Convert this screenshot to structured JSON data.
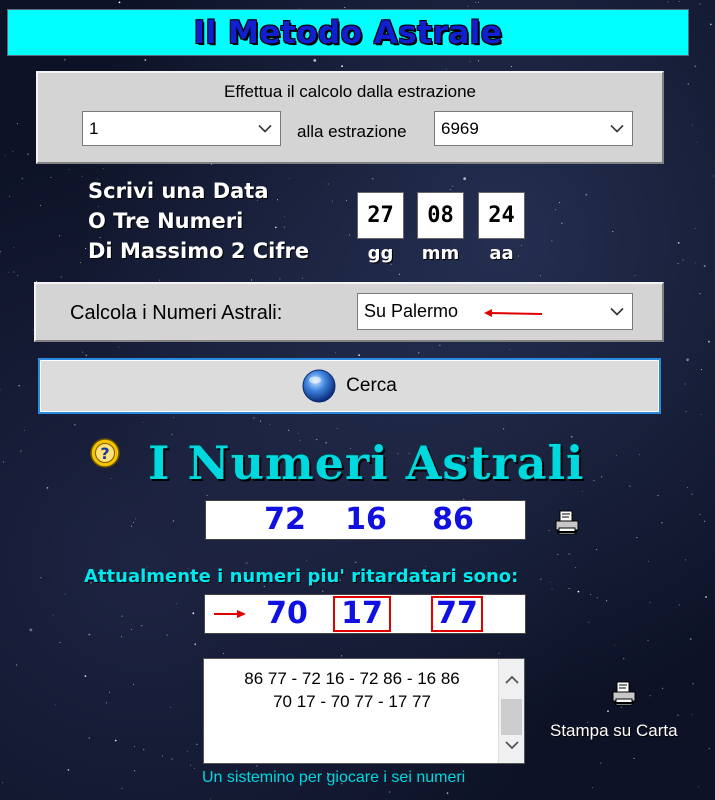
{
  "header": {
    "title": "Il Metodo Astrale"
  },
  "extraction": {
    "caption": "Effettua il calcolo dalla estrazione",
    "from_value": "1",
    "to_label": "alla estrazione",
    "to_value": "6969"
  },
  "date_input": {
    "prompt_lines": [
      "Scrivi una Data",
      "O Tre Numeri",
      "Di Massimo 2 Cifre"
    ],
    "fields": [
      {
        "value": "27",
        "caption": "gg"
      },
      {
        "value": "08",
        "caption": "mm"
      },
      {
        "value": "24",
        "caption": "aa"
      }
    ]
  },
  "wheel": {
    "label": "Calcola i Numeri  Astrali:",
    "selected": "Su Palermo"
  },
  "search_button": {
    "label": "Cerca"
  },
  "results": {
    "title": "I Numeri Astrali",
    "numbers": [
      "72",
      "16",
      "86"
    ],
    "status_text": "Attualmente  i numeri piu' ritardatari sono:",
    "late_numbers": [
      "70",
      "17",
      "77"
    ]
  },
  "combinations": {
    "lines": [
      "86 77 - 72 16 - 72 86 - 16 86",
      "70 17 - 70 77 - 17 77"
    ]
  },
  "print": {
    "label": "Stampa su Carta"
  },
  "footer": {
    "note": "Un sistemino per giocare i sei numeri"
  },
  "colors": {
    "title_bg": "#00ffff",
    "title_text": "#1020d0",
    "accent_cyan": "#00d8e0",
    "number_blue": "#1010e0",
    "highlight_red": "#e00000",
    "focus_border": "#2a8ae0"
  }
}
